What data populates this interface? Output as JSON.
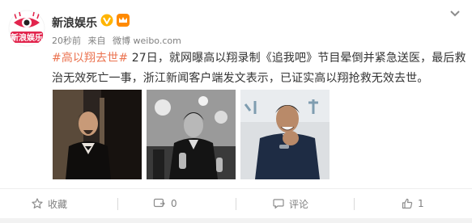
{
  "account": {
    "name": "新浪娱乐",
    "avatar_text": "新浪娱乐"
  },
  "meta": {
    "time": "20秒前",
    "source_prefix": "来自",
    "source": "微博 weibo.com"
  },
  "post": {
    "hashtag": "#高以翔去世#",
    "line1_rest": " 27日，就网曝高以翔录制《追我吧》节目晕倒并紧急送医，最后救",
    "line2": "治无效死亡一事，浙江新闻客户端发文表示，已证实高以翔抢救无效去世。"
  },
  "actions": {
    "favorite": "收藏",
    "repost": "0",
    "comment": "评论",
    "like": "1"
  },
  "colors": {
    "accent": "#eb7350",
    "verified": "#ffb400",
    "text": "#333333",
    "muted": "#808080"
  },
  "icons": [
    "weibo-eye-logo-icon",
    "verified-v-icon",
    "crown-icon",
    "more-chevron-icon",
    "star-icon",
    "repost-icon",
    "comment-icon",
    "thumbs-up-icon"
  ]
}
